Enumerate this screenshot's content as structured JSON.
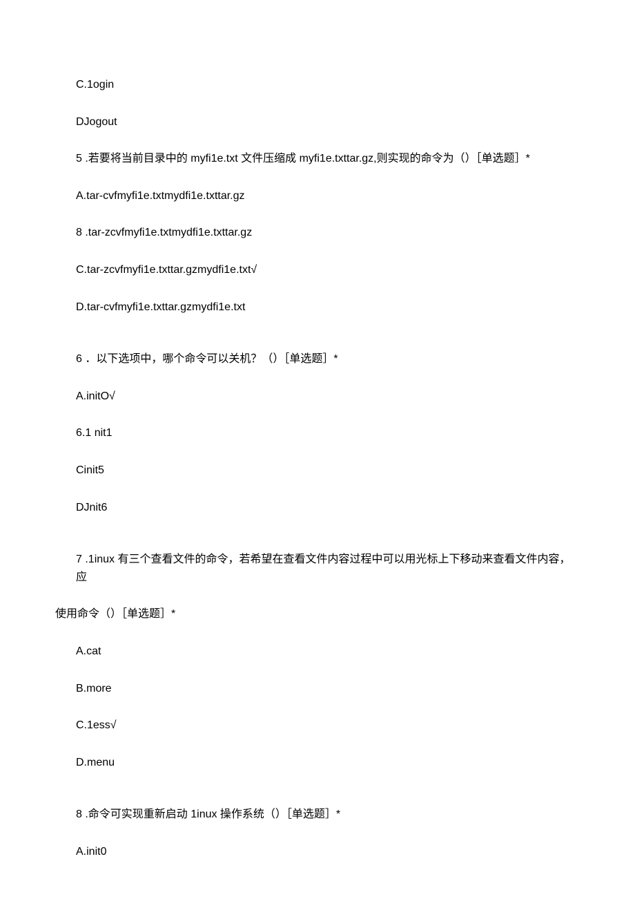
{
  "lines": [
    "C.1ogin",
    "DJogout"
  ],
  "q5": {
    "prompt": "5 .若要将当前目录中的 myfi1e.txt 文件压缩成 myfi1e.txttar.gz,则实现的命令为（）［单选题］*",
    "opts": [
      "A.tar-cvfmyfi1e.txtmydfi1e.txttar.gz",
      "8  .tar-zcvfmyfi1e.txtmydfi1e.txttar.gz",
      "C.tar-zcvfmyfi1e.txttar.gzmydfi1e.txt√",
      "D.tar-cvfmyfi1e.txttar.gzmydfi1e.txt"
    ]
  },
  "q6": {
    "prompt": "6 ．以下选项中，哪个命令可以关机？（）［单选题］*",
    "opts": [
      "A.initO√",
      "6.1  nit1",
      "Cinit5",
      "DJnit6"
    ]
  },
  "q7": {
    "prompt_l1": "7  .1inux 有三个查看文件的命令，若希望在查看文件内容过程中可以用光标上下移动来查看文件内容，应",
    "prompt_l2": "使用命令（）［单选题］*",
    "opts": [
      "A.cat",
      "B.more",
      "C.1ess√",
      "D.menu"
    ]
  },
  "q8": {
    "prompt": "8  .命令可实现重新启动 1inux 操作系统（）［单选题］*",
    "opts": [
      "A.init0"
    ]
  }
}
